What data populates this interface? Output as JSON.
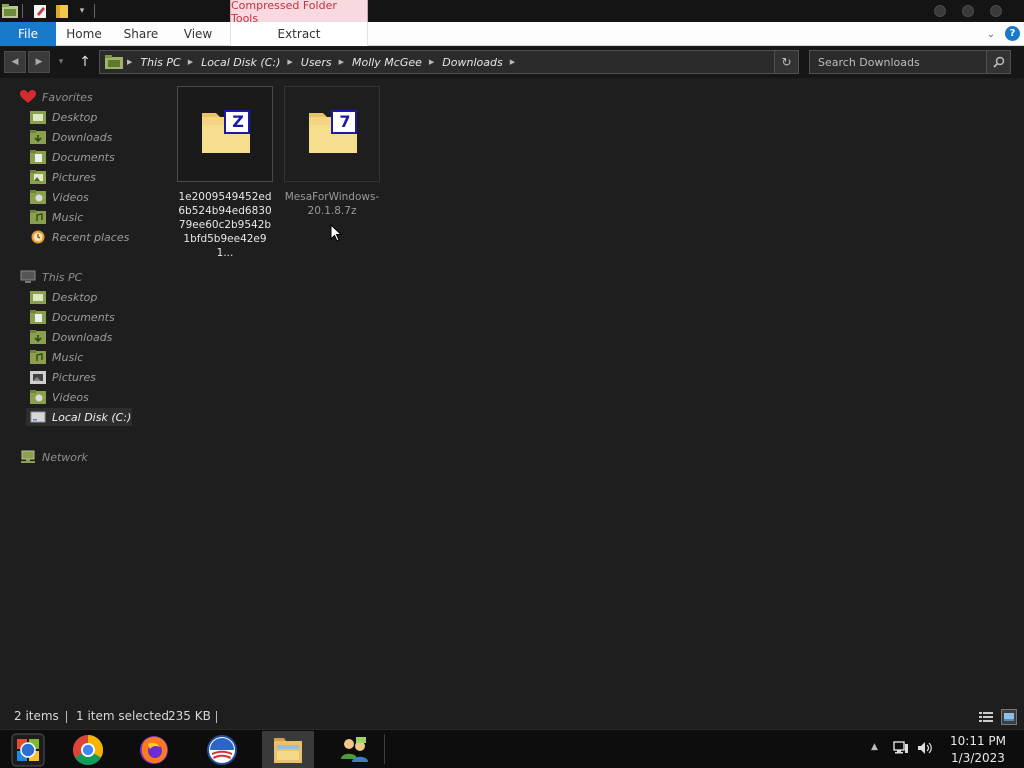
{
  "ribbon": {
    "contextual_group": "Compressed Folder Tools",
    "tabs": [
      "File",
      "Home",
      "Share",
      "View",
      "Extract"
    ]
  },
  "address": {
    "breadcrumbs": [
      "This PC",
      "Local Disk (C:)",
      "Users",
      "Molly McGee",
      "Downloads"
    ]
  },
  "search": {
    "placeholder": "Search Downloads"
  },
  "navpane": {
    "favorites": {
      "label": "Favorites",
      "items": [
        "Desktop",
        "Downloads",
        "Documents",
        "Pictures",
        "Videos",
        "Music",
        "Recent places"
      ]
    },
    "this_pc": {
      "label": "This PC",
      "items": [
        "Desktop",
        "Documents",
        "Downloads",
        "Music",
        "Pictures",
        "Videos",
        "Local Disk (C:)"
      ]
    },
    "network": {
      "label": "Network"
    }
  },
  "files": [
    {
      "name": "1e2009549452ed6b524b94ed683079ee60c2b9542b1bfd5b9ee42e91...",
      "badge": "Z",
      "icon": "zip-folder-icon",
      "selected": true
    },
    {
      "name": "MesaForWindows-20.1.8.7z",
      "badge": "7",
      "icon": "7z-archive-icon",
      "selected": false
    }
  ],
  "status": {
    "item_count": "2 items",
    "selection": "1 item selected",
    "size": "235 KB"
  },
  "taskbar": {
    "apps": [
      "start-icon",
      "chrome-icon",
      "firefox-icon",
      "obama-logo-icon",
      "file-explorer-icon",
      "network-users-icon"
    ],
    "time": "10:11 PM",
    "date": "1/3/2023"
  },
  "colors": {
    "file_tab": "#1979ca",
    "contextual_tab_bg": "#f7d9df",
    "contextual_tab_text": "#c0343f",
    "folder_yellow": "#f3d582",
    "badge_blue": "#1a1aa8"
  }
}
